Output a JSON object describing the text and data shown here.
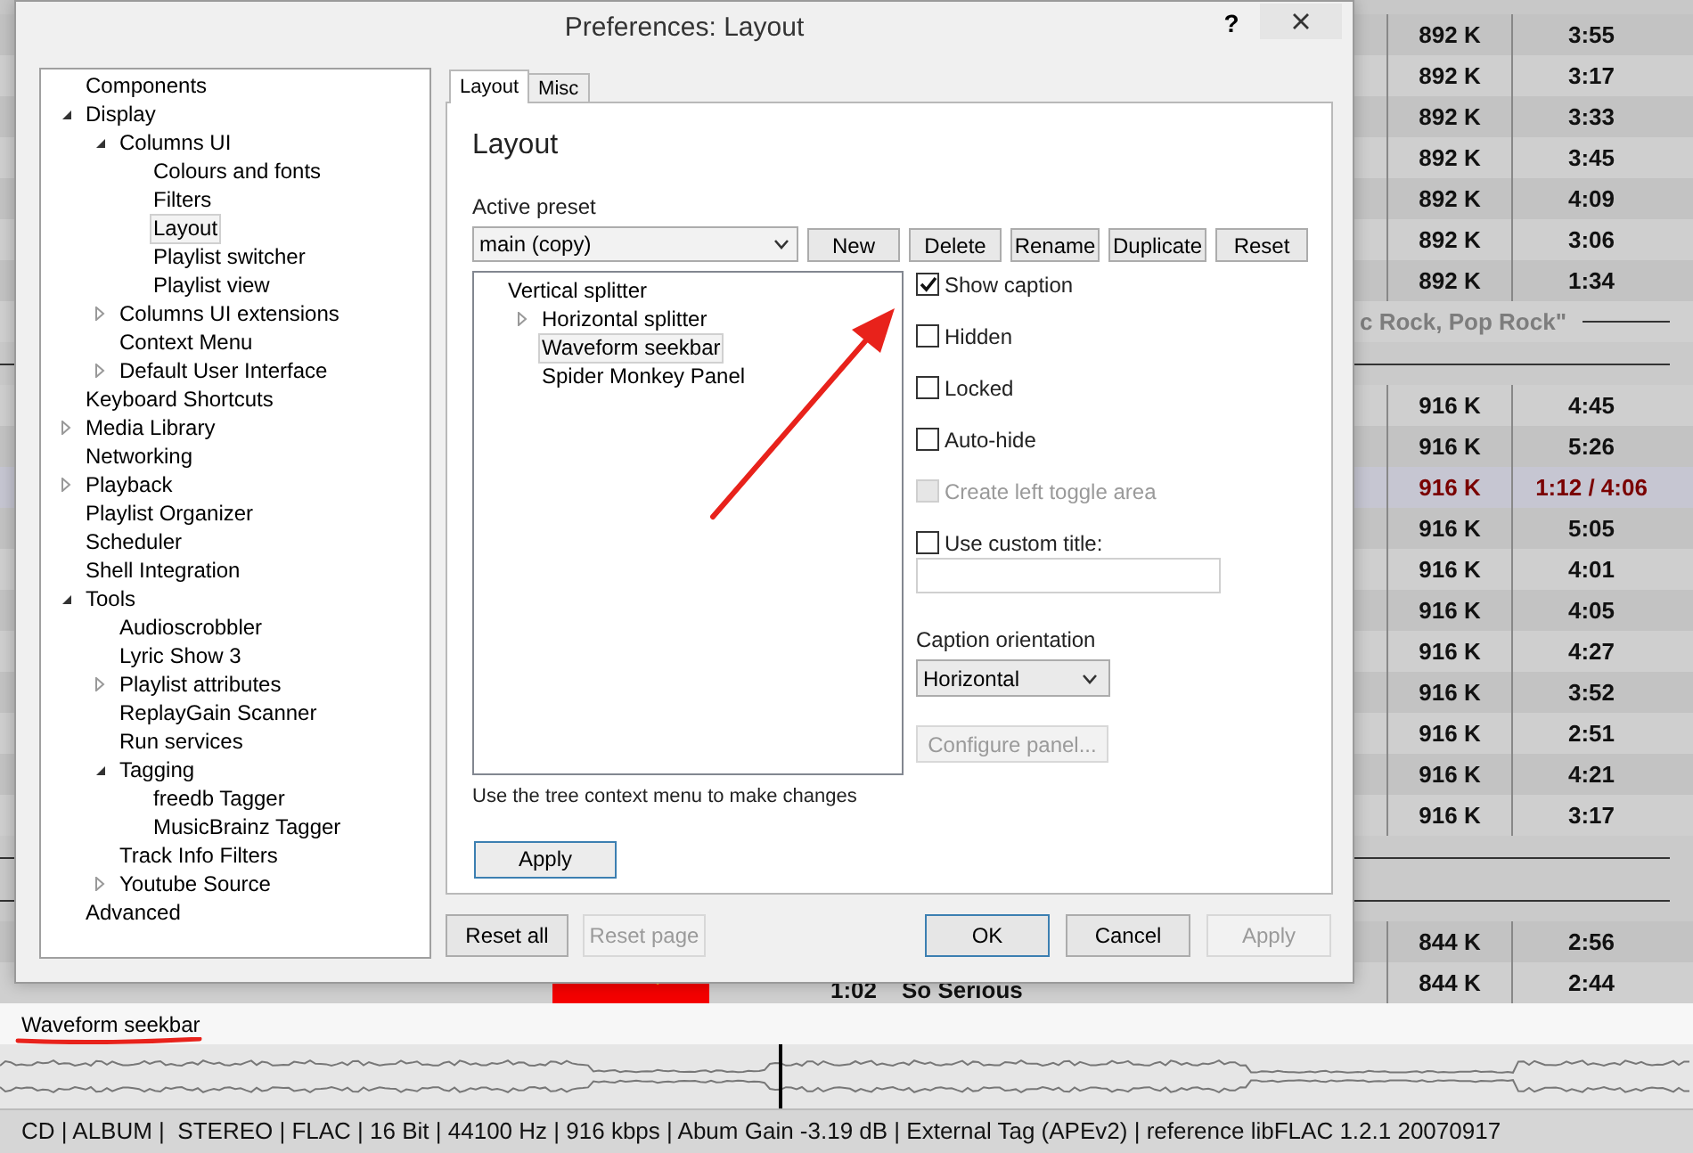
{
  "playlist": {
    "items": [
      {
        "kind": "header"
      },
      {
        "kind": "track",
        "bitrate": "892 K",
        "duration": "3:55",
        "playing": false
      },
      {
        "kind": "track",
        "bitrate": "892 K",
        "duration": "3:17",
        "playing": false
      },
      {
        "kind": "track",
        "bitrate": "892 K",
        "duration": "3:33",
        "playing": false
      },
      {
        "kind": "track",
        "bitrate": "892 K",
        "duration": "3:45",
        "playing": false
      },
      {
        "kind": "track",
        "bitrate": "892 K",
        "duration": "4:09",
        "playing": false
      },
      {
        "kind": "track",
        "bitrate": "892 K",
        "duration": "3:06",
        "playing": false
      },
      {
        "kind": "track",
        "bitrate": "892 K",
        "duration": "1:34",
        "playing": false
      },
      {
        "kind": "group",
        "text": "c Rock, Pop Rock\""
      },
      {
        "kind": "separator"
      },
      {
        "kind": "track",
        "bitrate": "916 K",
        "duration": "4:45",
        "playing": false
      },
      {
        "kind": "track",
        "bitrate": "916 K",
        "duration": "5:26",
        "playing": false
      },
      {
        "kind": "track",
        "bitrate": "916 K",
        "duration": "1:12 / 4:06",
        "playing": true
      },
      {
        "kind": "track",
        "bitrate": "916 K",
        "duration": "5:05",
        "playing": false
      },
      {
        "kind": "track",
        "bitrate": "916 K",
        "duration": "4:01",
        "playing": false
      },
      {
        "kind": "track",
        "bitrate": "916 K",
        "duration": "4:05",
        "playing": false
      },
      {
        "kind": "track",
        "bitrate": "916 K",
        "duration": "4:27",
        "playing": false
      },
      {
        "kind": "track",
        "bitrate": "916 K",
        "duration": "3:52",
        "playing": false
      },
      {
        "kind": "track",
        "bitrate": "916 K",
        "duration": "2:51",
        "playing": false
      },
      {
        "kind": "track",
        "bitrate": "916 K",
        "duration": "4:21",
        "playing": false
      },
      {
        "kind": "track",
        "bitrate": "916 K",
        "duration": "3:17",
        "playing": false
      },
      {
        "kind": "separator"
      },
      {
        "kind": "separator"
      },
      {
        "kind": "track",
        "bitrate": "844 K",
        "duration": "2:56",
        "playing": false
      },
      {
        "kind": "track",
        "bitrate": "844 K",
        "duration": "2:44",
        "playing": false,
        "column_1": "1:02",
        "column_2": "So Serious"
      }
    ]
  },
  "dialog": {
    "title": "Preferences: Layout",
    "help_button": "?",
    "tree": [
      {
        "label": "Components",
        "selected": false
      },
      {
        "label": "Display",
        "selected": false,
        "expanded": true,
        "children": [
          {
            "label": "Columns UI",
            "selected": false,
            "expanded": true,
            "children": [
              {
                "label": "Colours and fonts",
                "selected": false
              },
              {
                "label": "Filters",
                "selected": false
              },
              {
                "label": "Layout",
                "selected": true
              },
              {
                "label": "Playlist switcher",
                "selected": false
              },
              {
                "label": "Playlist view",
                "selected": false
              }
            ]
          },
          {
            "label": "Columns UI extensions",
            "selected": false,
            "expanded": false
          },
          {
            "label": "Context Menu",
            "selected": false
          },
          {
            "label": "Default User Interface",
            "selected": false,
            "expanded": false
          }
        ]
      },
      {
        "label": "Keyboard Shortcuts",
        "selected": false
      },
      {
        "label": "Media Library",
        "selected": false,
        "expanded": false
      },
      {
        "label": "Networking",
        "selected": false
      },
      {
        "label": "Playback",
        "selected": false,
        "expanded": false
      },
      {
        "label": "Playlist Organizer",
        "selected": false
      },
      {
        "label": "Scheduler",
        "selected": false
      },
      {
        "label": "Shell Integration",
        "selected": false
      },
      {
        "label": "Tools",
        "selected": false,
        "expanded": true,
        "children": [
          {
            "label": "Audioscrobbler",
            "selected": false
          },
          {
            "label": "Lyric Show 3",
            "selected": false
          },
          {
            "label": "Playlist attributes",
            "selected": false,
            "expanded": false
          },
          {
            "label": "ReplayGain Scanner",
            "selected": false
          },
          {
            "label": "Run services",
            "selected": false
          },
          {
            "label": "Tagging",
            "selected": false,
            "expanded": true,
            "children": [
              {
                "label": "freedb Tagger",
                "selected": false
              },
              {
                "label": "MusicBrainz Tagger",
                "selected": false
              }
            ]
          },
          {
            "label": "Track Info Filters",
            "selected": false
          },
          {
            "label": "Youtube Source",
            "selected": false,
            "expanded": false
          }
        ]
      },
      {
        "label": "Advanced",
        "selected": false
      }
    ],
    "tabs": [
      {
        "label": "Layout",
        "selected": true
      },
      {
        "label": "Misc",
        "selected": false
      }
    ],
    "page": {
      "heading": "Layout",
      "preset_label": "Active preset",
      "preset": "main (copy)",
      "preset_buttons": [
        "New",
        "Delete",
        "Rename",
        "Duplicate",
        "Reset"
      ],
      "layout_tree": [
        {
          "label": "Vertical splitter",
          "selected": false,
          "children": [
            {
              "label": "Horizontal splitter",
              "selected": false,
              "expanded": false
            },
            {
              "label": "Waveform seekbar",
              "selected": true
            },
            {
              "label": "Spider Monkey Panel",
              "selected": false
            }
          ]
        }
      ],
      "options": [
        {
          "label": "Show caption",
          "checked": true,
          "disabled": false
        },
        {
          "label": "Hidden",
          "checked": false,
          "disabled": false
        },
        {
          "label": "Locked",
          "checked": false,
          "disabled": false
        },
        {
          "label": "Auto-hide",
          "checked": false,
          "disabled": false
        },
        {
          "label": "Create left toggle area",
          "checked": false,
          "disabled": true
        },
        {
          "label": "Use custom title:",
          "checked": false,
          "disabled": false
        }
      ],
      "orientation_label": "Caption orientation",
      "orientation": "Horizontal",
      "configure_button": {
        "label": "Configure panel...",
        "disabled": true
      },
      "hint": "Use the tree context menu to make changes",
      "apply_button": "Apply"
    },
    "footer_left": [
      {
        "label": "Reset all",
        "disabled": false,
        "default": false
      },
      {
        "label": "Reset page",
        "disabled": true,
        "default": false
      }
    ],
    "footer_right": [
      {
        "label": "OK",
        "disabled": false,
        "default": true
      },
      {
        "label": "Cancel",
        "disabled": false,
        "default": false
      },
      {
        "label": "Apply",
        "disabled": true,
        "default": false
      }
    ]
  },
  "seekbar": {
    "caption": "Waveform seekbar"
  },
  "status_bar": "CD | ALBUM |  STEREO | FLAC | 16 Bit | 44100 Hz | 916 kbps | Abum Gain -3.19 dB | External Tag (APEv2) | reference libFLAC 1.2.1 20070917"
}
